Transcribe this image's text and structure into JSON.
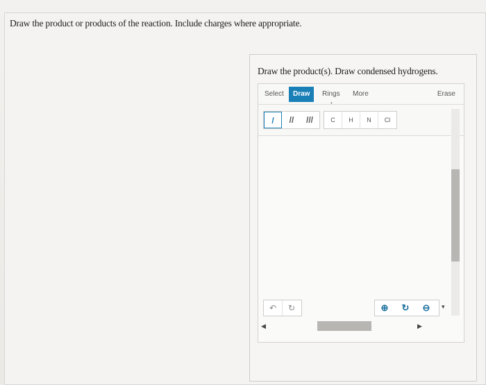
{
  "question": {
    "text": "Draw the product or products of the reaction. Include charges where appropriate."
  },
  "panel": {
    "title": "Draw the product(s). Draw condensed hydrogens."
  },
  "tabs": {
    "select": "Select",
    "draw": "Draw",
    "rings": "Rings",
    "more": "More",
    "erase": "Erase"
  },
  "bonds": {
    "single": "/",
    "double": "//",
    "triple": "///"
  },
  "atoms": {
    "c": "C",
    "h": "H",
    "n": "N",
    "cl": "Cl"
  },
  "icons": {
    "undo": "undo-icon",
    "redo": "redo-icon",
    "zoom_in": "zoom-in-icon",
    "zoom_reset": "zoom-reset-icon",
    "zoom_out": "zoom-out-icon",
    "caret_down": "caret-down-icon",
    "scroll_left": "arrow-left-icon",
    "scroll_right": "arrow-right-icon"
  },
  "colors": {
    "accent": "#1a7fb7",
    "zoom_icon": "#1a6f9e"
  }
}
